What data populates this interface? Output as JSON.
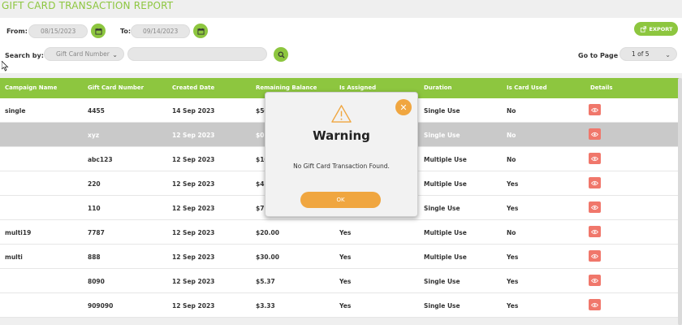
{
  "page_title": "GIFT CARD TRANSACTION REPORT",
  "filters": {
    "from_label": "From:",
    "from_value": "08/15/2023",
    "to_label": "To:",
    "to_value": "09/14/2023",
    "search_label": "Search by:",
    "search_by_value": "Gift Card Number",
    "search_input_value": "",
    "export_label": "EXPORT",
    "go_to_page_label": "Go to Page",
    "page_value": "1 of 5"
  },
  "table": {
    "headers": [
      "Campaign Name",
      "Gift Card Number",
      "Created Date",
      "Remaining Balance",
      "Is Assigned",
      "Duration",
      "Is Card Used",
      "Details"
    ],
    "rows": [
      [
        "single",
        "4455",
        "14 Sep 2023",
        "$50",
        "",
        "Single Use",
        "No"
      ],
      [
        "",
        "xyz",
        "12 Sep 2023",
        "$0",
        "",
        "Single Use",
        "No"
      ],
      [
        "",
        "abc123",
        "12 Sep 2023",
        "$10",
        "",
        "Multiple Use",
        "No"
      ],
      [
        "",
        "220",
        "12 Sep 2023",
        "$4.",
        "",
        "Multiple Use",
        "Yes"
      ],
      [
        "",
        "110",
        "12 Sep 2023",
        "$7.",
        "",
        "Single Use",
        "Yes"
      ],
      [
        "multi19",
        "7787",
        "12 Sep 2023",
        "$20.00",
        "Yes",
        "Multiple Use",
        "No"
      ],
      [
        "multi",
        "888",
        "12 Sep 2023",
        "$30.00",
        "Yes",
        "Multiple Use",
        "Yes"
      ],
      [
        "",
        "8090",
        "12 Sep 2023",
        "$5.37",
        "Yes",
        "Single Use",
        "Yes"
      ],
      [
        "",
        "909090",
        "12 Sep 2023",
        "$3.33",
        "Yes",
        "Single Use",
        "Yes"
      ]
    ]
  },
  "modal": {
    "title": "Warning",
    "message": "No Gift Card Transaction Found.",
    "ok_label": "OK",
    "close_glyph": "✕"
  },
  "colors": {
    "accent": "#8dc63f",
    "warning": "#f0a640",
    "details": "#f0776b"
  }
}
